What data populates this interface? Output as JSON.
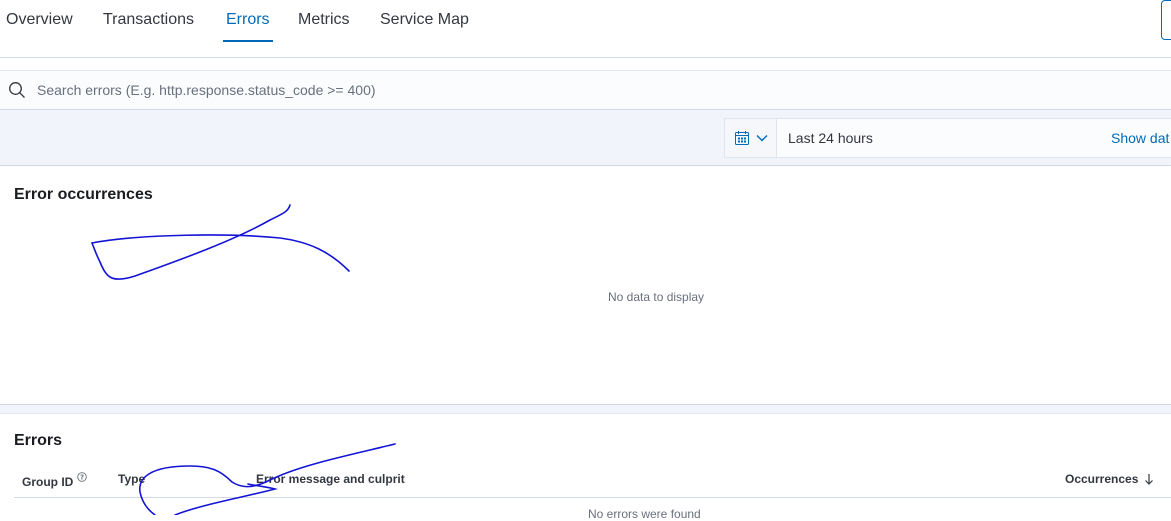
{
  "tabs": [
    {
      "label": "Overview"
    },
    {
      "label": "Transactions"
    },
    {
      "label": "Errors",
      "active": true
    },
    {
      "label": "Metrics"
    },
    {
      "label": "Service Map"
    }
  ],
  "search": {
    "placeholder": "Search errors (E.g. http.response.status_code >= 400)",
    "value": ""
  },
  "date_picker": {
    "range_label": "Last 24 hours",
    "show_dates_label": "Show dat"
  },
  "occurrences_panel": {
    "title": "Error occurrences",
    "empty_text": "No data to display"
  },
  "errors_panel": {
    "title": "Errors",
    "columns": {
      "group_id": "Group ID",
      "type": "Type",
      "message": "Error message and culprit",
      "occurrences": "Occurrences"
    },
    "empty_text": "No errors were found"
  },
  "icons": {
    "search": "search-icon",
    "calendar": "calendar-icon",
    "chevron": "chevron-down-icon",
    "info": "info-icon",
    "sort": "arrow-down-icon"
  },
  "colors": {
    "accent": "#006bb8",
    "annotation_ink": "#1414d6",
    "text": "#343741",
    "subdued": "#69707d"
  }
}
